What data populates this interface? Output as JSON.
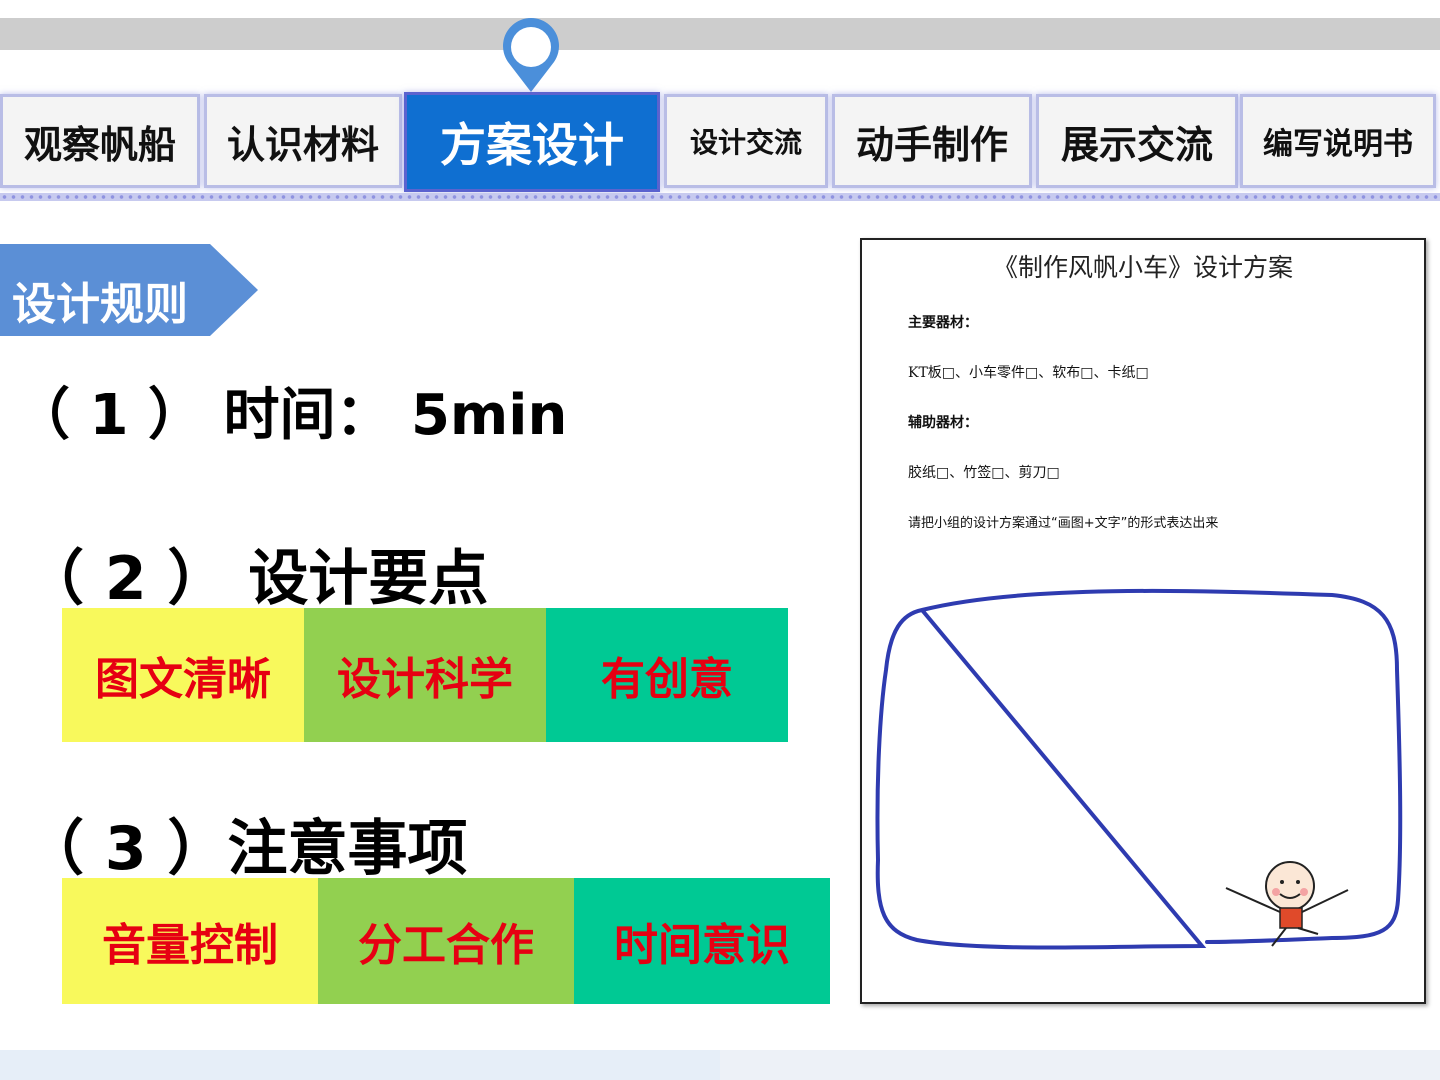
{
  "tabs": [
    {
      "label": "观察帆船",
      "active": false
    },
    {
      "label": "认识材料",
      "active": false
    },
    {
      "label": "方案设计",
      "active": true
    },
    {
      "label": "设计交流",
      "active": false
    },
    {
      "label": "动手制作",
      "active": false
    },
    {
      "label": "展示交流",
      "active": false
    },
    {
      "label": "编写说明书",
      "active": false
    }
  ],
  "rules": {
    "heading": "设计规则",
    "item1": "（ 1 ） 时间： 5min",
    "item2": "（ 2 ）  设计要点",
    "points": [
      "图文清晰",
      "设计科学",
      "有创意"
    ],
    "item3": "（ 3 ）注意事项",
    "notes": [
      "音量控制",
      "分工合作",
      "时间意识"
    ]
  },
  "document": {
    "title": "《制作风帆小车》设计方案",
    "main_materials_label": "主要器材：",
    "main_materials": "KT板□、小车零件□、软布□、卡纸□",
    "aux_materials_label": "辅助器材：",
    "aux_materials": "胶纸□、竹签□、剪刀□",
    "instruction": "请把小组的设计方案通过“画图+文字”的形式表达出来"
  },
  "colors": {
    "active_tab": "#0f6fd1",
    "banner": "#5b8fd6",
    "point_text": "#e60012",
    "yellow": "#f8f95c",
    "green": "#92d050",
    "teal": "#00c994",
    "frame": "#2e3bb0"
  }
}
